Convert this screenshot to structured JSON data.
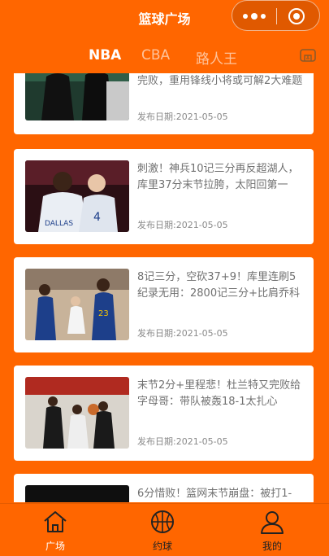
{
  "app": {
    "title": "篮球广场"
  },
  "tabs": [
    {
      "label": "NBA",
      "active": true
    },
    {
      "label": "CBA",
      "active": false
    },
    {
      "label": "路人王",
      "active": false
    }
  ],
  "articles": [
    {
      "title": "完败，重用锋线小将或可解2大难题",
      "date": "发布日期:2021-05-05"
    },
    {
      "title": "刺激！神兵10记三分再反超湖人，库里37分末节拉胯，太阳回第一",
      "date": "发布日期:2021-05-05"
    },
    {
      "title": "8记三分，空砍37+9！库里连刷5纪录无用：2800记三分+比肩乔科",
      "date": "发布日期:2021-05-05"
    },
    {
      "title": "末节2分+里程悲！杜兰特又完败给字母哥：带队被轰18-1太扎心",
      "date": "发布日期:2021-05-05"
    },
    {
      "title": "6分惜败！篮网末节崩盘：被打1-",
      "date": ""
    }
  ],
  "bottom_nav": [
    {
      "label": "广场",
      "icon": "home-icon",
      "active": true
    },
    {
      "label": "约球",
      "icon": "basketball-icon",
      "active": false
    },
    {
      "label": "我的",
      "icon": "user-icon",
      "active": false
    }
  ],
  "colors": {
    "brand": "#FF6600",
    "card": "#FFFFFF",
    "text": "#707070"
  }
}
